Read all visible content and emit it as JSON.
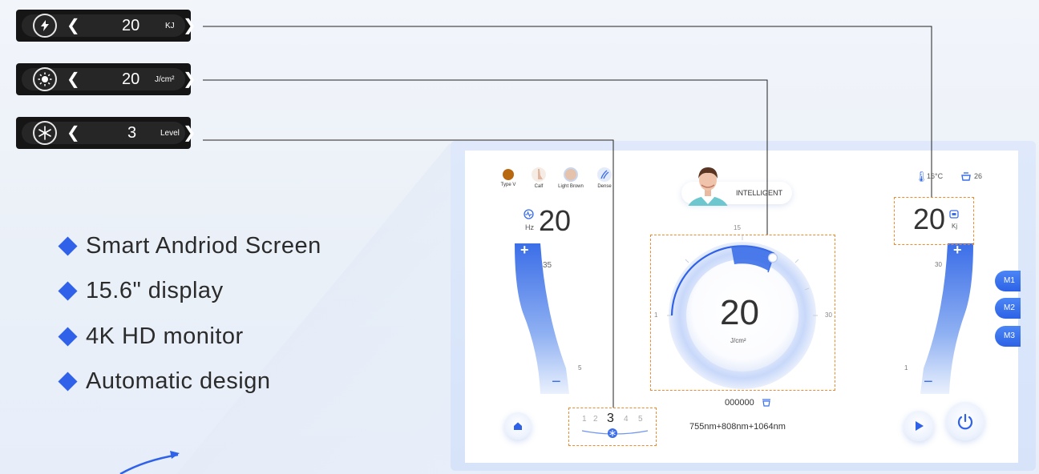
{
  "controls": [
    {
      "icon": "lightning-bolt-icon",
      "value": "20",
      "unit": "KJ"
    },
    {
      "icon": "sun-icon",
      "value": "20",
      "unit": "J/cm²"
    },
    {
      "icon": "snowflake-icon",
      "value": "3",
      "unit": "Level"
    }
  ],
  "features": [
    "Smart Andriod Screen",
    "15.6\" display",
    "4K HD monitor",
    "Automatic design"
  ],
  "screen": {
    "skin_options": [
      {
        "label": "Type V",
        "icon": "skin-color-dot-icon",
        "color": "#b8680e"
      },
      {
        "label": "Calf",
        "icon": "leg-icon",
        "color": "#e9c7b6"
      },
      {
        "label": "Light Brown",
        "icon": "face-icon",
        "color": "#e4c2ab"
      },
      {
        "label": "Dense",
        "icon": "hair-icon",
        "color": "#3a6ee8"
      }
    ],
    "mode_label": "INTELLIGENT",
    "temperature": "16°C",
    "water_count": "26",
    "frequency": {
      "value": "20",
      "unit": "Hz"
    },
    "left_slider": {
      "max_label": "35",
      "min_label": "5",
      "plus": "+",
      "minus": "−"
    },
    "dial": {
      "value": "20",
      "unit": "J/cm²",
      "min_label": "1",
      "mid_label": "15",
      "max_label": "30",
      "level_fraction": 0.63
    },
    "energy": {
      "value": "20",
      "unit": "Kj"
    },
    "right_slider": {
      "max_label": "30",
      "min_label": "1",
      "plus": "+",
      "minus": "−"
    },
    "counter": "000000",
    "wavelength": "755nm+808nm+1064nm",
    "cooling_levels": [
      "1",
      "2",
      "3",
      "4",
      "5"
    ],
    "cooling_selected": "3",
    "memory_buttons": [
      "M1",
      "M2",
      "M3"
    ]
  },
  "colors": {
    "accent": "#2f62e8",
    "callout_border": "#f08a2a",
    "pill_bg": "#151515"
  }
}
